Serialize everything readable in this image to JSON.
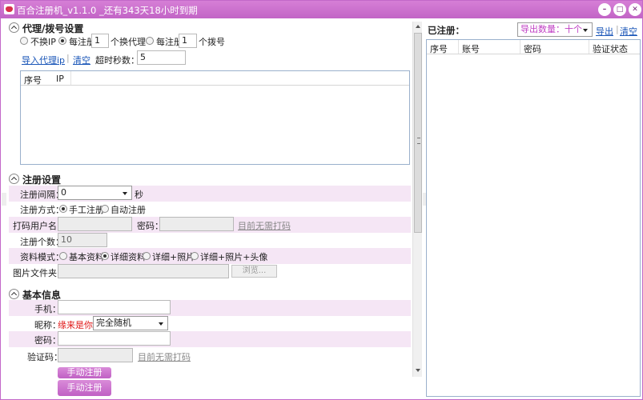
{
  "window": {
    "title": "百合注册机_v1.1.0 _还有343天18小时到期",
    "min_label": "–",
    "max_label": "□",
    "close_label": "✕"
  },
  "proxy": {
    "heading": "代理/拨号设置",
    "opt_none": "不换IP",
    "opt_reg_prefix": "每注册",
    "opt_reg_value": "1",
    "opt_reg_suffix": "个换代理",
    "opt_dial_prefix": "每注册",
    "opt_dial_value": "1",
    "opt_dial_suffix": "个拨号",
    "import_link": "导入代理ip",
    "clear_link": "清空",
    "timeout_label": "超时秒数：",
    "timeout_value": "5",
    "table_headers": [
      "序号",
      "IP"
    ]
  },
  "register": {
    "heading": "注册设置",
    "interval_label": "注册间隔：",
    "interval_value": "0",
    "interval_unit": "秒",
    "method_label": "注册方式：",
    "method_manual": "手工注册",
    "method_auto": "自动注册",
    "captcha_user_label": "打码用户名：",
    "captcha_pwd_label": "密码：",
    "captcha_link": "目前无需打码",
    "count_label": "注册个数：",
    "count_value": "10",
    "mode_label": "资料模式：",
    "mode_basic": "基本资料",
    "mode_detail": "详细资料",
    "mode_detail_photo": "详细+照片",
    "mode_detail_photo_avatar": "详细+照片+头像",
    "folder_label": "图片文件夹：",
    "browse_label": "浏览..."
  },
  "basic": {
    "heading": "基本信息",
    "phone_label": "手机：",
    "nick_label": "昵称：",
    "nick_value": "缘来是你",
    "nick_select": "完全随机",
    "pwd_label": "密码：",
    "captcha_label": "验证码：",
    "captcha_link": "目前无需打码",
    "manual_button": "手动注册",
    "manual_button_hidden": "手动注册"
  },
  "registered": {
    "heading": "已注册：",
    "export_select": "导出数量：十个",
    "export_link": "导出",
    "clear_link": "清空",
    "table_headers": [
      "序号",
      "账号",
      "密码",
      "验证状态"
    ]
  }
}
